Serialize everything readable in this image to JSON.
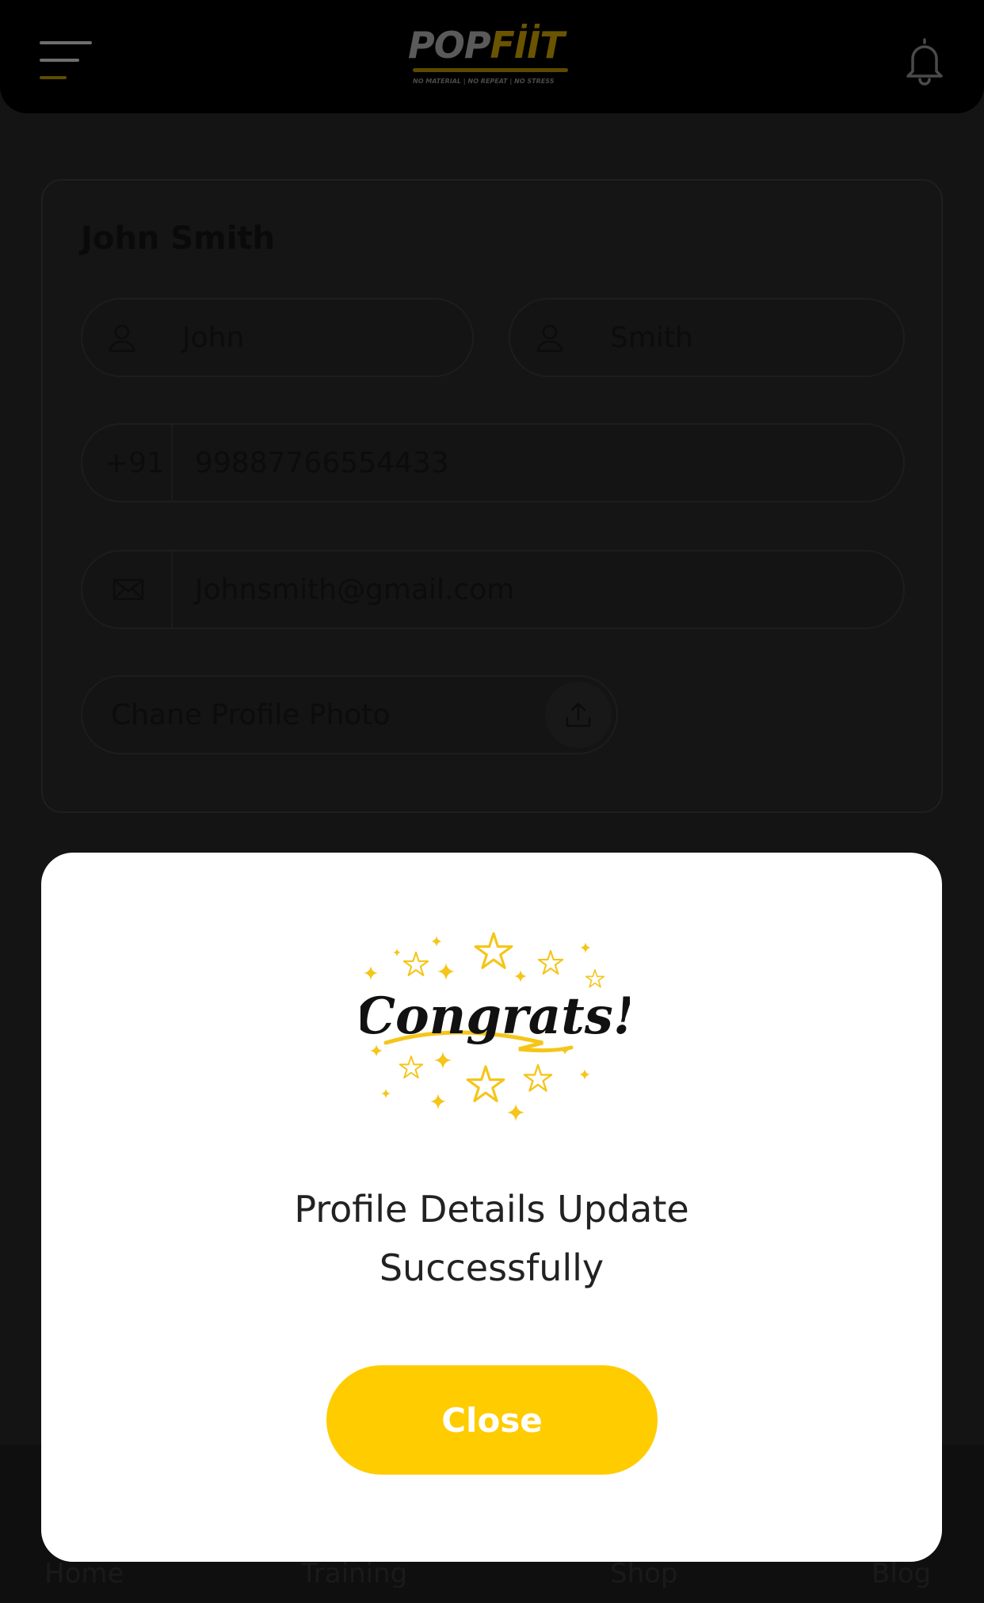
{
  "header": {
    "logo": {
      "text_pop": "POP",
      "text_fit": "FİİT",
      "tagline": "NO MATERIAL | NO REPEAT | NO STRESS"
    },
    "menu_icon": "hamburger-icon",
    "bell_icon": "bell-icon"
  },
  "profile": {
    "full_name": "John Smith",
    "first_name": "John",
    "last_name": "Smith",
    "country_code": "+91",
    "phone": "99887766554433",
    "email": "Johnsmith@gmail.com",
    "change_photo_label": "Chane Profile Photo",
    "icons": {
      "user": "user-icon",
      "mail": "mail-icon",
      "upload": "upload-icon"
    }
  },
  "bottom_nav": {
    "items": [
      {
        "label": "Home"
      },
      {
        "label": "Training"
      },
      {
        "label": "Shop"
      },
      {
        "label": "Blog"
      }
    ]
  },
  "modal": {
    "art_text": "Congrats!",
    "message": "Profile Details Update\nSuccessfully",
    "close_label": "Close"
  },
  "colors": {
    "accent": "#ffcc00",
    "overlay_bg": "#141414",
    "modal_bg": "#ffffff",
    "header_bg": "#000000"
  }
}
